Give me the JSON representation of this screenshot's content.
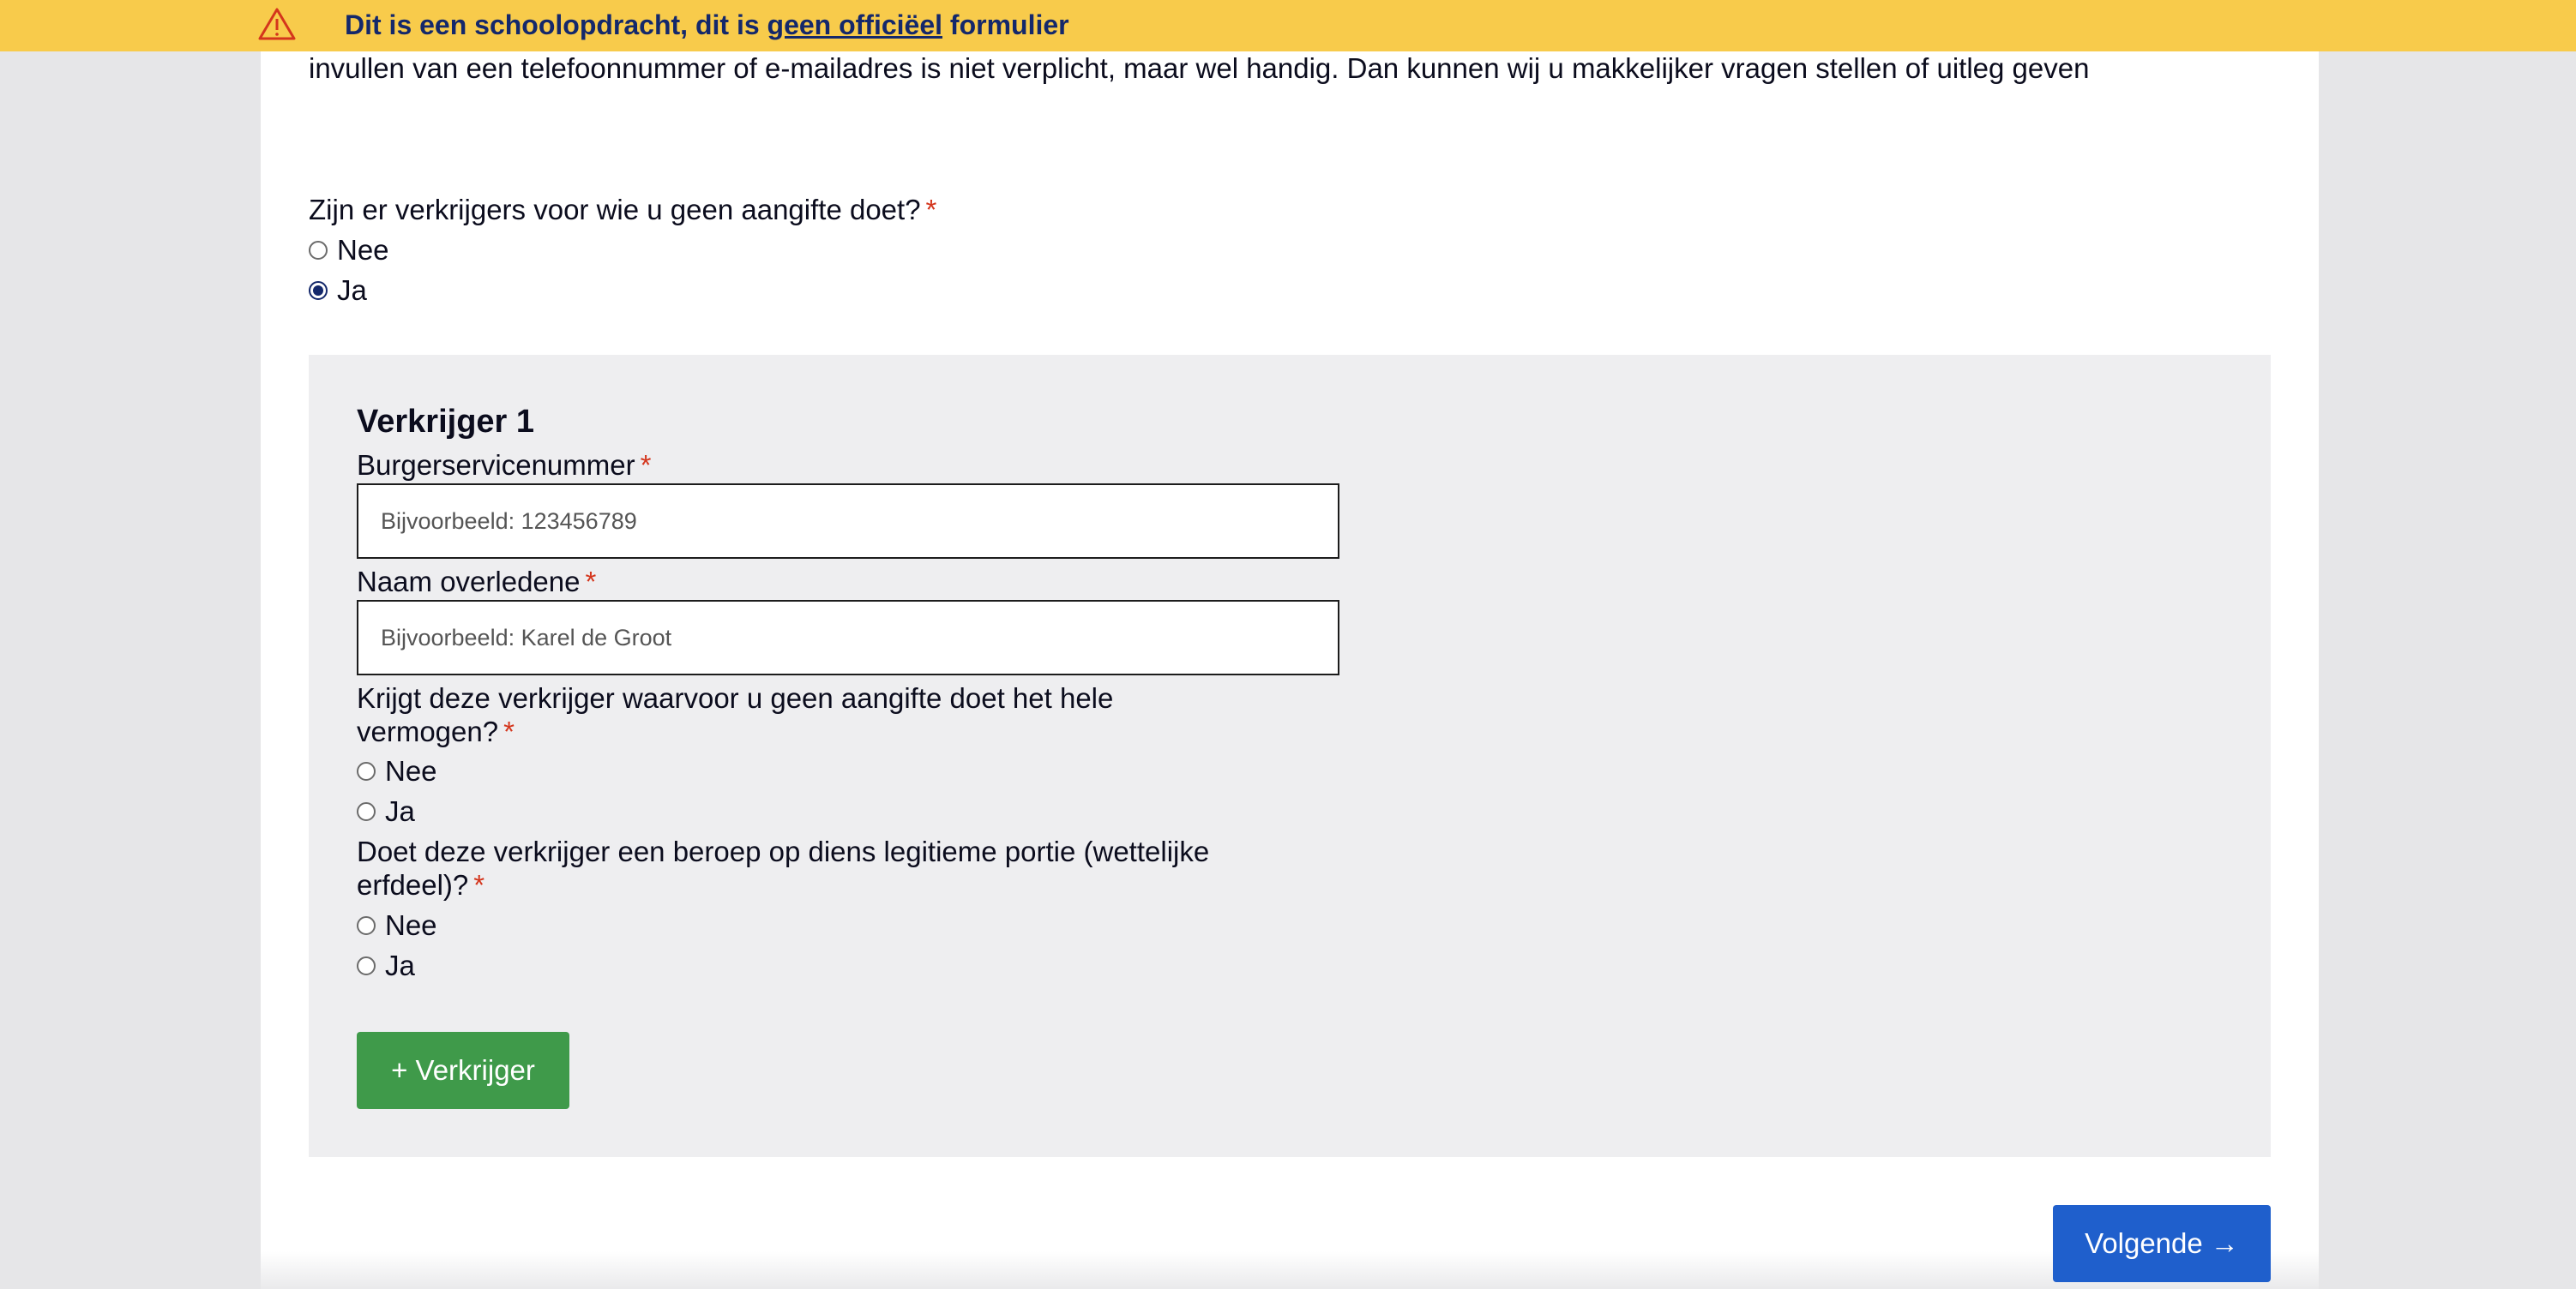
{
  "banner": {
    "text_before": "Dit is een schoolopdracht, dit is ",
    "link_text": "geen officiëel",
    "text_after": " formulier",
    "icon": "warning-triangle-icon",
    "background": "#f8cb4b",
    "text_color": "#14286b"
  },
  "intro": {
    "text": "invullen van een telefoonnummer of e-mailadres is niet verplicht, maar wel handig. Dan kunnen wij u makkelijker vragen stellen of uitleg geven"
  },
  "question_main": {
    "label": "Zijn er verkrijgers voor wie u geen aangifte doet?",
    "required_mark": "*",
    "options": [
      "Nee",
      "Ja"
    ],
    "selected": "Ja"
  },
  "verkrijger": {
    "title": "Verkrijger 1",
    "bsn": {
      "label": "Burgerservicenummer",
      "required_mark": "*",
      "placeholder": "Bijvoorbeeld: 123456789",
      "value": ""
    },
    "naam": {
      "label": "Naam overledene",
      "required_mark": "*",
      "placeholder": "Bijvoorbeeld: Karel de Groot",
      "value": ""
    },
    "q_vermogen": {
      "label_line1": "Krijgt deze verkrijger waarvoor u geen aangifte doet het hele",
      "label_line2": "vermogen?",
      "required_mark": "*",
      "options": [
        "Nee",
        "Ja"
      ],
      "selected": null
    },
    "q_portie": {
      "label_line1": "Doet deze verkrijger een beroep op diens legitieme portie (wettelijke",
      "label_line2": "erfdeel)?",
      "required_mark": "*",
      "options": [
        "Nee",
        "Ja"
      ],
      "selected": null
    },
    "add_button_label": "+ Verkrijger"
  },
  "navigation": {
    "next_label": "Volgende →"
  },
  "colors": {
    "add_button": "#3f9a4a",
    "next_button": "#1f5fcc",
    "required": "#d4351c",
    "panel": "#eeeef0"
  }
}
